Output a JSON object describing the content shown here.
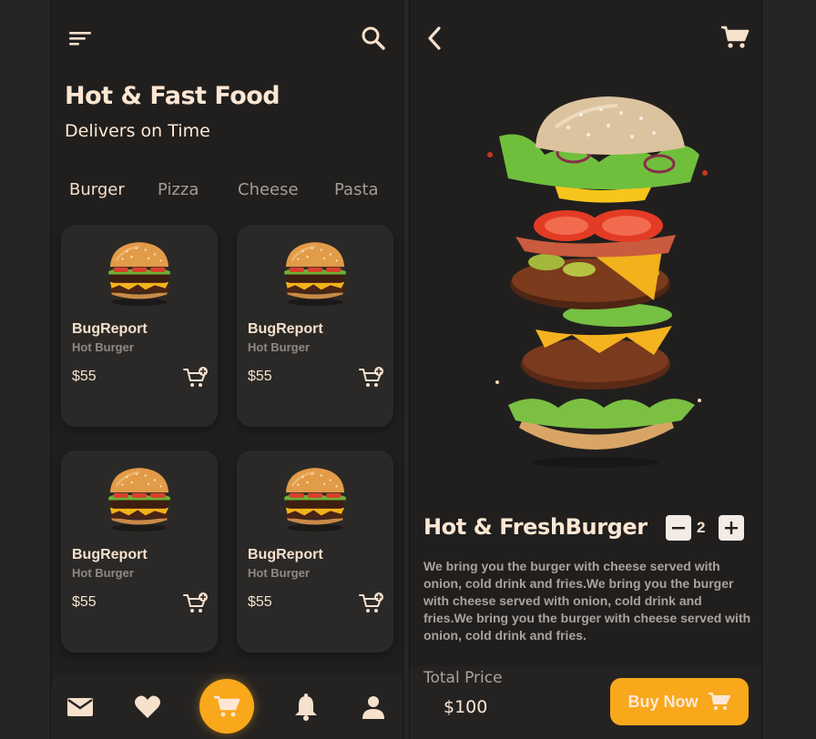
{
  "home": {
    "title": "Hot & Fast Food",
    "subtitle": "Delivers on Time",
    "tabs": [
      {
        "label": "Burger",
        "active": true
      },
      {
        "label": "Pizza",
        "active": false
      },
      {
        "label": "Cheese",
        "active": false
      },
      {
        "label": "Pasta",
        "active": false
      }
    ],
    "products": [
      {
        "name": "BugReport",
        "subtitle": "Hot Burger",
        "price": "$55"
      },
      {
        "name": "BugReport",
        "subtitle": "Hot Burger",
        "price": "$55"
      },
      {
        "name": "BugReport",
        "subtitle": "Hot Burger",
        "price": "$55"
      },
      {
        "name": "BugReport",
        "subtitle": "Hot Burger",
        "price": "$55"
      }
    ],
    "bottom_nav": [
      "mail-icon",
      "heart-icon",
      "cart-icon",
      "bell-icon",
      "user-icon"
    ]
  },
  "detail": {
    "title": "Hot & FreshBurger",
    "quantity": "2",
    "description": "We bring you the burger with cheese served with onion, cold drink and fries.We bring you the burger with cheese served with onion, cold drink and fries.We bring you the burger with cheese served with onion, cold drink and fries.",
    "total_label": "Total Price",
    "total_value": "$100",
    "buy_label": "Buy Now"
  },
  "colors": {
    "accent": "#f9a81b",
    "background": "#211f1e",
    "card": "#2b2927",
    "text_primary": "#fde7d4",
    "text_muted": "#a9a39c"
  }
}
